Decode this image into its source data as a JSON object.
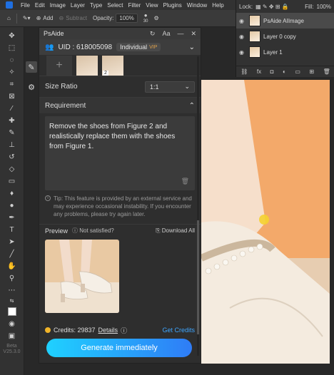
{
  "menubar": {
    "items": [
      "File",
      "Edit",
      "Image",
      "Layer",
      "Type",
      "Select",
      "Filter",
      "View",
      "Plugins",
      "Window",
      "Help"
    ]
  },
  "optionsbar": {
    "add_label": "Add",
    "subtract_label": "Subtract",
    "opacity_label": "Opacity:",
    "opacity_value": "100%",
    "brush_size": "30"
  },
  "layers": {
    "lock_label": "Lock:",
    "fill_label": "Fill:",
    "fill_value": "100%",
    "items": [
      {
        "name": "PsAide AIImage",
        "selected": true
      },
      {
        "name": "Layer 0 copy",
        "selected": false
      },
      {
        "name": "Layer 1",
        "selected": false
      }
    ]
  },
  "plugin": {
    "title": "PsAide",
    "uid_label": "UID : 618005098",
    "plan": "Individual",
    "plan_badge": "VIP",
    "size_ratio_label": "Size Ratio",
    "size_ratio_value": "1:1",
    "requirement_label": "Requirement",
    "requirement_text": "Remove the shoes from Figure 2 and realistically replace them with the shoes from Figure 1.",
    "tip": "Tip: This feature is provided by an external service and may experience occasional instability. If you encounter any problems, please try again later.",
    "preview_label": "Preview",
    "not_satisfied_label": "Not satisfied?",
    "download_all_label": "Download All",
    "credits_label": "Credits: 29837",
    "details_label": "Details",
    "get_credits_label": "Get Credits",
    "generate_label": "Generate immediately",
    "figure_badge": "2"
  },
  "toolbar": {
    "beta_line1": "Beta",
    "beta_line2": "V25.3.0"
  }
}
